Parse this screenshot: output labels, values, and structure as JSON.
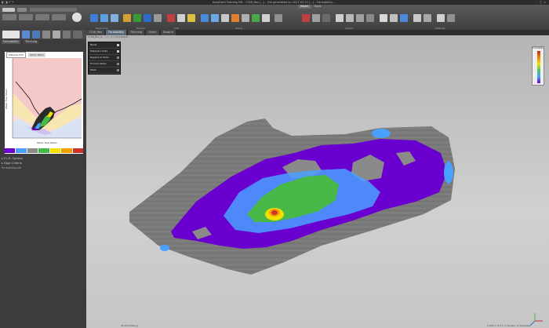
{
  "window": {
    "title": "AutoForm Forming R8 – 1708_Rev [...] – Die generated on 2017-03-21 [...] – Formability: ..."
  },
  "ribbon": {
    "tabs": [
      "Model",
      "Tools"
    ],
    "active_tab": "Model",
    "groups": [
      "Resources",
      "Results",
      "Edit",
      "Setup",
      "Layout",
      "Settings"
    ]
  },
  "left_panel": {
    "tabs": [
      "Formability",
      "Thinning"
    ],
    "active_tab": "Formability",
    "plot_tabs": [
      "Material FLD",
      "Strain Paths"
    ],
    "active_plot_tab": "Material FLD",
    "y_axis_label": "Major True Strain",
    "x_axis_label": "Minor True Strain",
    "legend": [
      {
        "label": "Crack",
        "color": "#d03030"
      },
      {
        "label": "Risk of crack",
        "color": "#f2a000"
      },
      {
        "label": "Excess thinning",
        "color": "#f2e000"
      },
      {
        "label": "Safe",
        "color": "#48b848"
      },
      {
        "label": "Insufficient stretch",
        "color": "#8a8a8a"
      },
      {
        "label": "Compress",
        "color": "#4aa0ff"
      },
      {
        "label": "Thickening",
        "color": "#6a00d0"
      }
    ],
    "settings_label": "F.L.D. Options",
    "edge_label": "Edge Criteria",
    "file_label": "formability.afd"
  },
  "document_tabs": [
    "1708_Rev",
    "Formability",
    "Thinning",
    "Strain",
    "Draw-in"
  ],
  "active_doc_tab": "Formability",
  "viewport": {
    "path": "1708_Rev_R... > [...] > Formability",
    "tree": [
      {
        "label": "Blank",
        "checked": true
      },
      {
        "label": "Material Limits",
        "checked": true
      },
      {
        "label": "Regions & Tools",
        "checked": false
      },
      {
        "label": "Process Steps",
        "checked": false
      },
      {
        "label": "Mesh",
        "checked": false
      }
    ],
    "scale": {
      "title": "Formability",
      "colors": [
        "#cc2222",
        "#e68a00",
        "#f2e000",
        "#55c060",
        "#4aa0ff",
        "#6a00d0"
      ]
    },
    "status_left": "25.00 Drawing",
    "status_right": "1,000 × 0.5 × 1 (Scale) / 2 Variables"
  },
  "colors": {
    "thickening": "#6a00d0",
    "compress": "#4aa0ff",
    "safe": "#48b848",
    "risk": "#f2a000",
    "crack": "#d03030",
    "insufficient": "#8a8a8a"
  }
}
